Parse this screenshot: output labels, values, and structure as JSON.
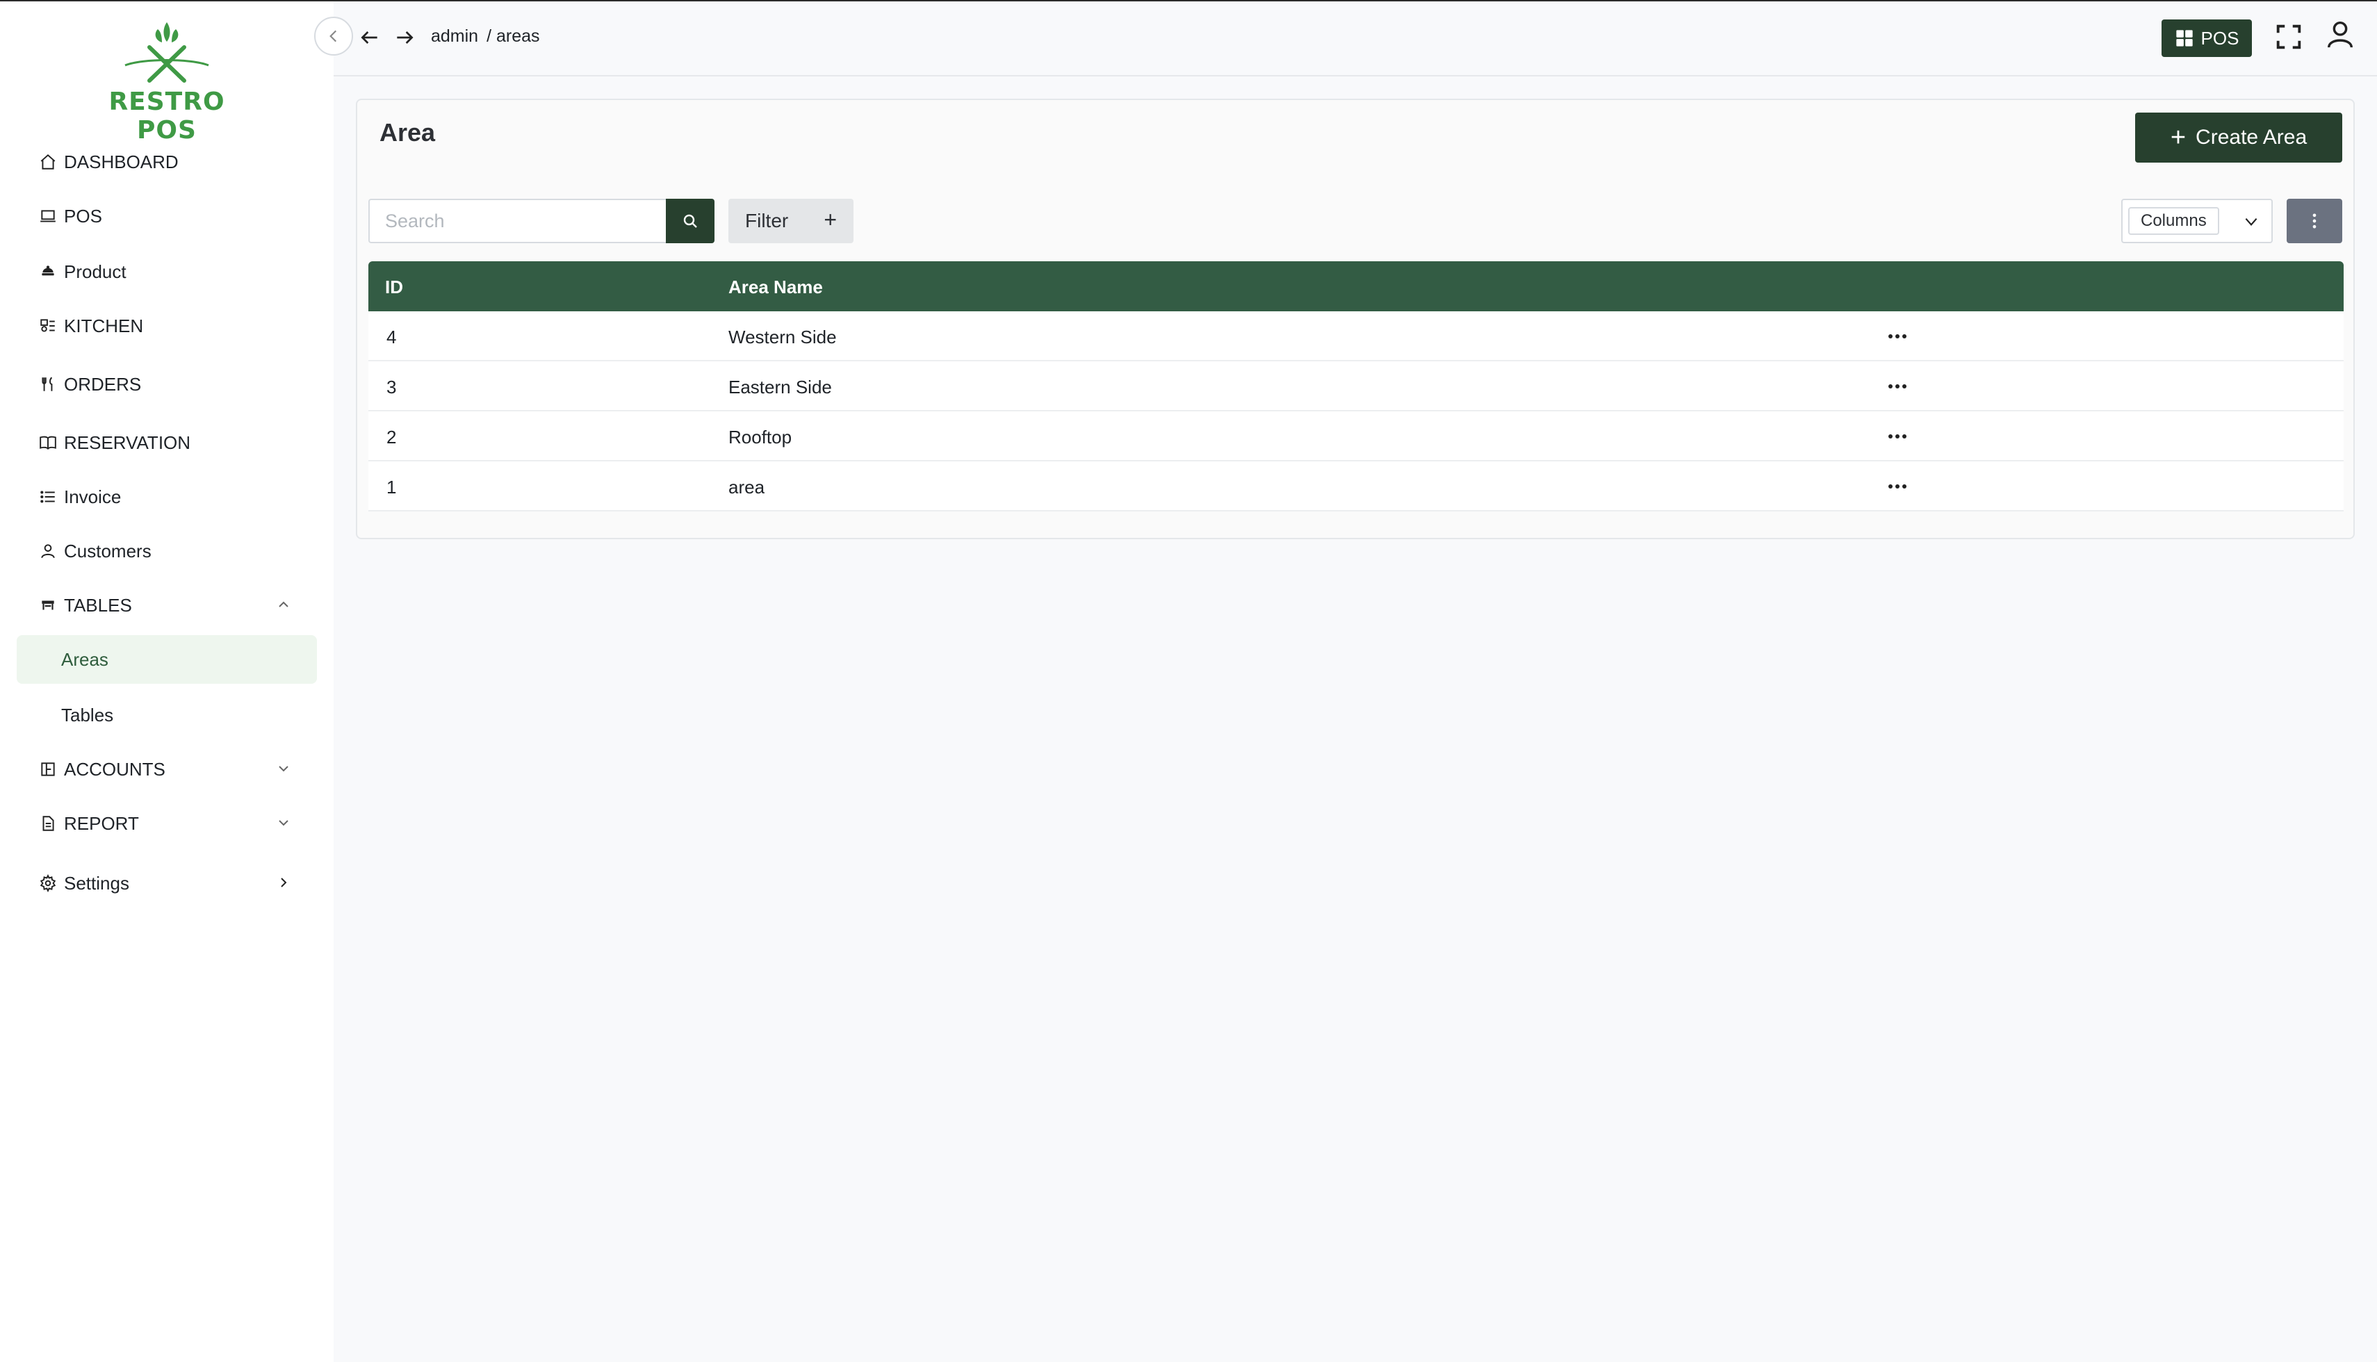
{
  "app": {
    "logo_text": "RESTRO POS"
  },
  "sidebar": {
    "items": [
      {
        "label": "DASHBOARD",
        "icon": "home-icon"
      },
      {
        "label": "POS",
        "icon": "laptop-icon"
      },
      {
        "label": "Product",
        "icon": "food-icon"
      },
      {
        "label": "KITCHEN",
        "icon": "kitchen-icon"
      },
      {
        "label": "ORDERS",
        "icon": "utensils-icon"
      },
      {
        "label": "RESERVATION",
        "icon": "book-icon"
      },
      {
        "label": "Invoice",
        "icon": "list-icon"
      },
      {
        "label": "Customers",
        "icon": "user-icon"
      },
      {
        "label": "TABLES",
        "icon": "table-icon",
        "expanded": true,
        "children": [
          {
            "label": "Areas",
            "active": true
          },
          {
            "label": "Tables"
          }
        ]
      },
      {
        "label": "ACCOUNTS",
        "icon": "ledger-icon"
      },
      {
        "label": "REPORT",
        "icon": "document-icon"
      },
      {
        "label": "Settings",
        "icon": "gear-icon"
      }
    ]
  },
  "header": {
    "breadcrumb": [
      "admin",
      "/ areas"
    ],
    "pos_label": "POS"
  },
  "page": {
    "title": "Area",
    "create_label": "Create Area",
    "search_placeholder": "Search",
    "search_value": "",
    "filter_label": "Filter",
    "columns_label": "Columns"
  },
  "table": {
    "columns": [
      "ID",
      "Area Name"
    ],
    "rows": [
      {
        "id": "4",
        "name": "Western Side"
      },
      {
        "id": "3",
        "name": "Eastern Side"
      },
      {
        "id": "2",
        "name": "Rooftop"
      },
      {
        "id": "1",
        "name": "area"
      }
    ]
  },
  "colors": {
    "brand_dark": "#27402e",
    "table_header": "#335c44",
    "logo_green": "#3f9a45",
    "active_bg": "#eef6ee"
  }
}
